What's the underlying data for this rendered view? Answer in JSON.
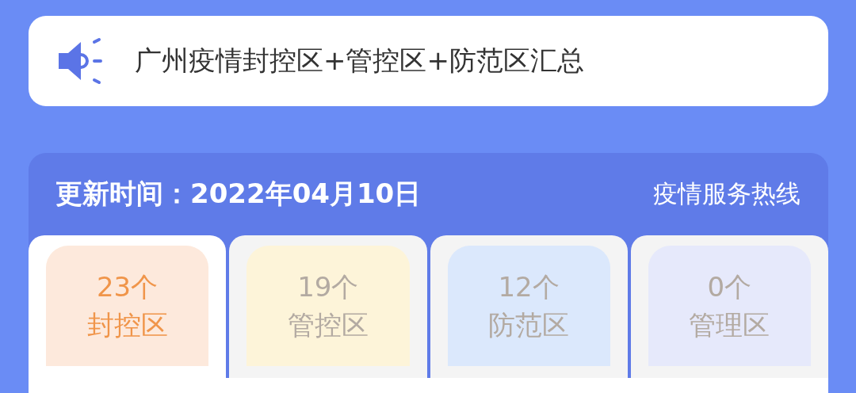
{
  "notice": {
    "title": "广州疫情封控区+管控区+防范区汇总"
  },
  "summary": {
    "updated_label": "更新时间：2022年04月10日",
    "hotline": "疫情服务热线",
    "tabs": [
      {
        "count": "23个",
        "label": "封控区",
        "selected": true,
        "color": "#fde9dc"
      },
      {
        "count": "19个",
        "label": "管控区",
        "selected": false,
        "color": "#fdf4d9"
      },
      {
        "count": "12个",
        "label": "防范区",
        "selected": false,
        "color": "#dbe8fc"
      },
      {
        "count": "0个",
        "label": "管理区",
        "selected": false,
        "color": "#e6e9fb"
      }
    ]
  }
}
